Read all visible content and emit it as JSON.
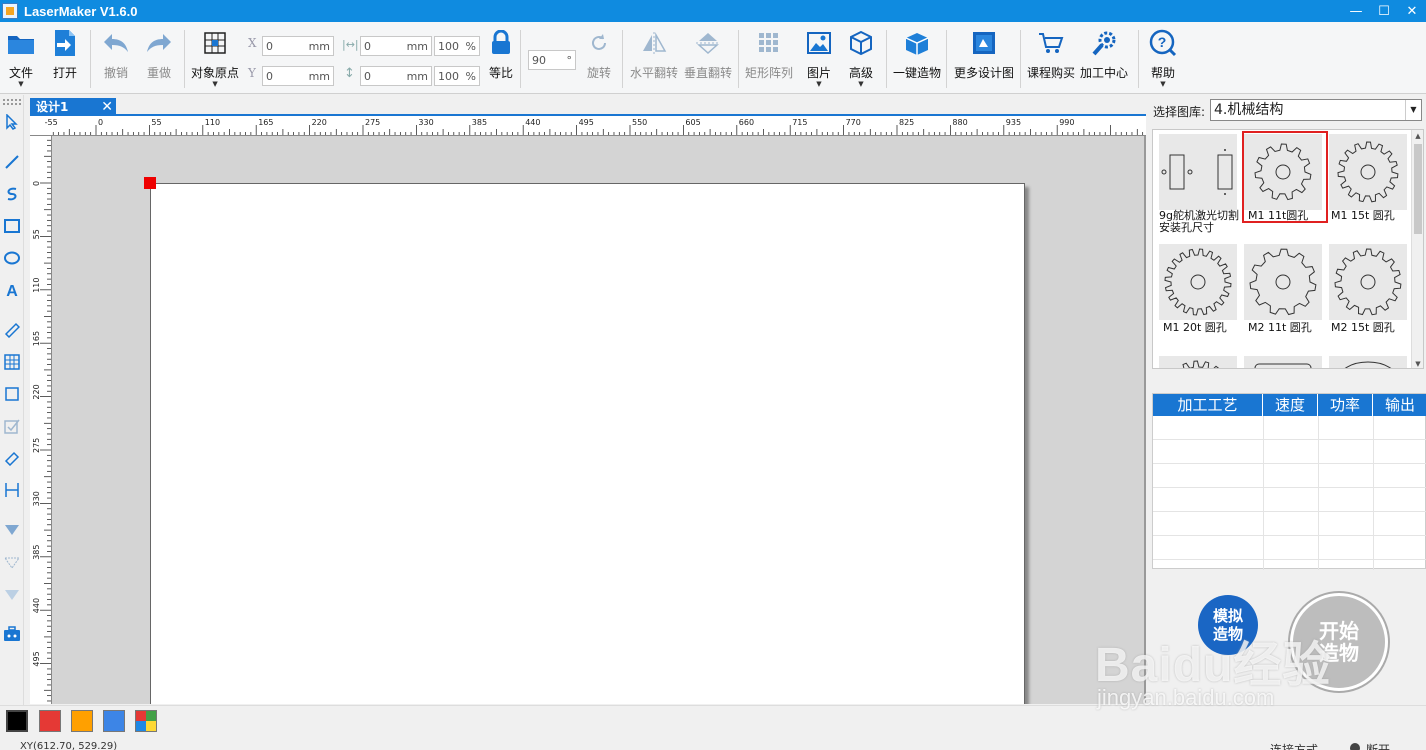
{
  "window": {
    "title": "LaserMaker V1.6.0",
    "controls": [
      "—",
      "☐",
      "✕"
    ]
  },
  "toolbar": {
    "file": "文件",
    "open": "打开",
    "undo": "撤销",
    "redo": "重做",
    "origin": "对象原点",
    "x_label": "X",
    "y_label": "Y",
    "x_value": "0",
    "y_value": "0",
    "w_value": "0",
    "h_value": "0",
    "unit": "mm",
    "w_pct": "100",
    "h_pct": "100",
    "pct": "%",
    "lock": "等比",
    "rotate_value": "90",
    "degree": "°",
    "rotate": "旋转",
    "flip_h": "水平翻转",
    "flip_v": "垂直翻转",
    "array": "矩形阵列",
    "image": "图片",
    "advanced": "高级",
    "one_click": "一键造物",
    "more_designs": "更多设计图",
    "buy_course": "课程购买",
    "process_center": "加工中心",
    "help": "帮助"
  },
  "tabs": [
    {
      "label": "设计1",
      "close": "✕"
    }
  ],
  "ruler": {
    "corner_unit": "mm",
    "top_ticks": [
      "-55",
      "0",
      "55",
      "110",
      "165",
      "220",
      "275",
      "330",
      "385",
      "440",
      "495",
      "550",
      "605",
      "660",
      "715",
      "770",
      "825",
      "880",
      "935",
      "990"
    ],
    "left_ticks": [
      "0",
      "55",
      "110",
      "165",
      "220",
      "275",
      "330",
      "385",
      "440",
      "495"
    ]
  },
  "library": {
    "label": "选择图库:",
    "selected": "4.机械结构",
    "items": [
      {
        "caption": "9g舵机激光切割安装孔尺寸",
        "icon": "servo-mount-icon"
      },
      {
        "caption": "M1 11t圆孔",
        "icon": "gear-11t-icon"
      },
      {
        "caption": "M1 15t 圆孔",
        "icon": "gear-15t-icon"
      },
      {
        "caption": "M1 20t 圆孔",
        "icon": "gear-20t-icon"
      },
      {
        "caption": "M2 11t 圆孔",
        "icon": "gear-11t-icon"
      },
      {
        "caption": "M2 15t 圆孔",
        "icon": "gear-15t-icon"
      }
    ]
  },
  "process_table": {
    "headers": [
      "加工工艺",
      "速度",
      "功率",
      "输出"
    ],
    "rows": 6
  },
  "actions": {
    "simulate": "模拟造物",
    "simulate_line1": "模拟",
    "simulate_line2": "造物",
    "start_line1": "开始",
    "start_line2": "造物"
  },
  "palette": {
    "colors": [
      "#000000",
      "#e53935",
      "#ffa000",
      "#3d85e6",
      "multi"
    ]
  },
  "status": {
    "coords": "XY(612.70, 529.29)",
    "connection": "连接方式",
    "state": "断开"
  },
  "watermark": {
    "logo": "Baidu经验",
    "url": "jingyan.baidu.com"
  },
  "colors": {
    "titlebar": "#0f8be0",
    "accent": "#1976d2",
    "highlight": "#e02020",
    "origin_marker": "#ee0000"
  }
}
